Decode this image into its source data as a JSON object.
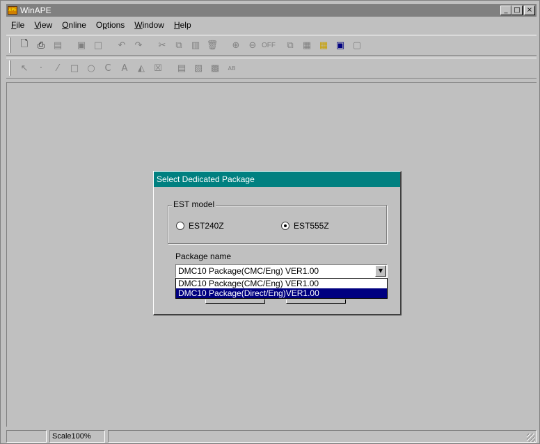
{
  "window": {
    "title": "WinAPE",
    "controls": [
      "_",
      "□",
      "×"
    ]
  },
  "menu": [
    {
      "label": "File",
      "underline": "F",
      "rest": "ile"
    },
    {
      "label": "View",
      "underline": "V",
      "rest": "iew"
    },
    {
      "label": "Online",
      "underline": "O",
      "rest": "nline"
    },
    {
      "label": "Options",
      "pre": "O",
      "underline": "p",
      "rest": "tions"
    },
    {
      "label": "Window",
      "underline": "W",
      "rest": "indow"
    },
    {
      "label": "Help",
      "underline": "H",
      "rest": "elp"
    }
  ],
  "toolbar1": {
    "icons": [
      "new-file-icon",
      "open-file-icon",
      "save-icon",
      "print-preview-icon",
      "frame-icon",
      "undo-icon",
      "redo-icon",
      "cut-icon",
      "copy-icon",
      "paste-icon",
      "delete-icon",
      "zoom-in-icon",
      "zoom-out-icon"
    ],
    "zoom_off_label": "OFF",
    "icons_after": [
      "layer-icon",
      "grid-icon",
      "yellow-grid-icon",
      "view-icon",
      "window-icon"
    ]
  },
  "toolbar2": {
    "icons": [
      "select-arrow-icon",
      "point-icon",
      "line-icon",
      "rectangle-icon",
      "circle-icon",
      "arc-icon",
      "text-icon",
      "fill-icon",
      "check-icon",
      "dialog-icon",
      "image-icon",
      "object-icon",
      "ab-icon"
    ]
  },
  "dialog": {
    "title": "Select Dedicated Package",
    "group_label": "EST model",
    "radio_options": [
      {
        "label": "EST240Z",
        "checked": false
      },
      {
        "label": "EST555Z",
        "checked": true
      }
    ],
    "package_label": "Package name",
    "combo_value": "DMC10 Package(CMC/Eng) VER1.00",
    "dropdown_items": [
      {
        "label": "DMC10 Package(CMC/Eng) VER1.00",
        "selected": false
      },
      {
        "label": "DMC10 Package(Direct/Eng)VER1.00",
        "selected": true
      }
    ]
  },
  "status": {
    "pane0": "",
    "scale": "Scale100%",
    "pane2": ""
  },
  "colors": {
    "titlebar": "#808080",
    "dialog_title": "#008080",
    "selection": "#000080",
    "face": "#c0c0c0"
  }
}
